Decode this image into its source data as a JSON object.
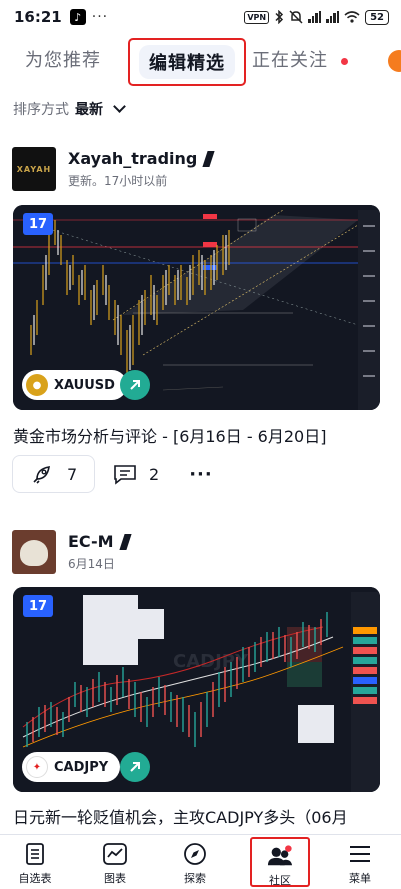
{
  "status_bar": {
    "time": "16:21",
    "vpn": "VPN",
    "battery": "52"
  },
  "tabs": [
    {
      "label": "为您推荐",
      "selected": false
    },
    {
      "label": "编辑精选",
      "selected": true
    },
    {
      "label": "正在关注",
      "selected": false,
      "has_dot": true
    }
  ],
  "sort": {
    "label": "排序方式",
    "value": "最新"
  },
  "posts": [
    {
      "author": "Xayah_trading",
      "avatar_text": "XAYAH",
      "time": "更新。17小时以前",
      "symbol": "XAUUSD",
      "title": "黄金市场分析与评论 - [6月16日 - 6月20日]",
      "boosts": "7",
      "comments": "2"
    },
    {
      "author": "EC-M",
      "time": "6月14日",
      "symbol": "CADJPY",
      "chart_watermark": "CADJPY",
      "title": "日元新一轮贬值机会，主攻CADJPY多头（06月"
    }
  ],
  "bottom_nav": [
    {
      "label": "自选表",
      "icon": "watchlist-icon"
    },
    {
      "label": "图表",
      "icon": "chart-icon"
    },
    {
      "label": "探索",
      "icon": "compass-icon"
    },
    {
      "label": "社区",
      "icon": "community-icon",
      "active": true
    },
    {
      "label": "菜单",
      "icon": "menu-icon"
    }
  ],
  "colors": {
    "accent_red": "#e32222",
    "brand_blue": "#2962ff",
    "chart_bg": "#131722",
    "boost_green": "#22ab94"
  }
}
